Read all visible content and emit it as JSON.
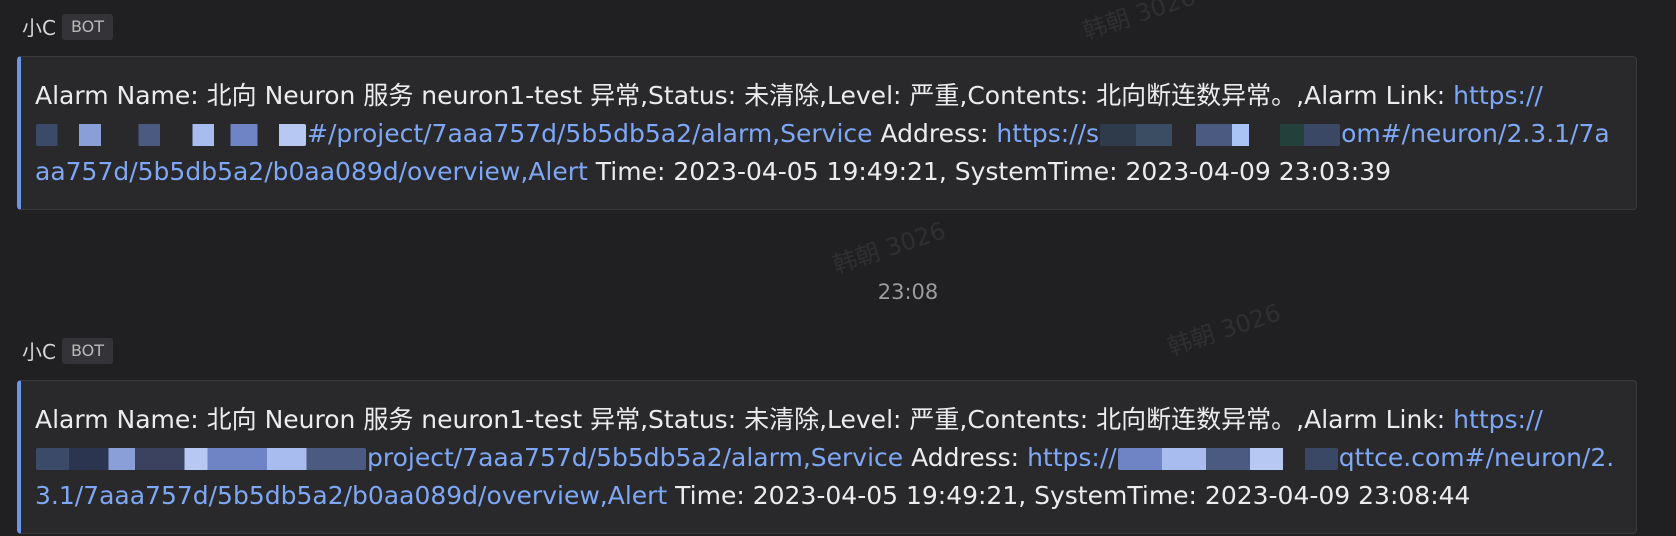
{
  "messages": [
    {
      "sender": "小C",
      "badge": "BOT",
      "text_pre": "Alarm Name: 北向 Neuron 服务 neuron1-test 异常,Status: 未清除,Level: 严重,Contents: 北向断连数异常。,Alarm Link: ",
      "link1_start": "https://",
      "link1_end": "#/project/7aaa757d/5b5db5a2/alarm,Service",
      "text_mid": " Address: ",
      "link2_start": "https://s",
      "link2_end": "om#/neuron/2.3.1/7aaa757d/5b5db5a2/b0aa089d/overview,Alert",
      "text_post": " Time: 2023-04-05 19:49:21, SystemTime: 2023-04-09 23:03:39"
    },
    {
      "sender": "小C",
      "badge": "BOT",
      "text_pre": "Alarm Name: 北向 Neuron 服务 neuron1-test 异常,Status: 未清除,Level: 严重,Contents: 北向断连数异常。,Alarm Link: ",
      "link1_start": "https://",
      "link1_end": "project/7aaa757d/5b5db5a2/alarm,Service",
      "text_mid": " Address: ",
      "link2_start": "https://",
      "link2_end": "qttce.com#/neuron/2.3.1/7aaa757d/5b5db5a2/b0aa089d/overview,Alert",
      "text_post": " Time: 2023-04-05 19:49:21, SystemTime: 2023-04-09 23:08:44"
    }
  ],
  "divider_time": "23:08",
  "watermark_text": "韩朝 3026",
  "colors": {
    "background": "#202022",
    "card": "#29292c",
    "accent": "#6d96ea",
    "link": "#7ea7f5"
  }
}
